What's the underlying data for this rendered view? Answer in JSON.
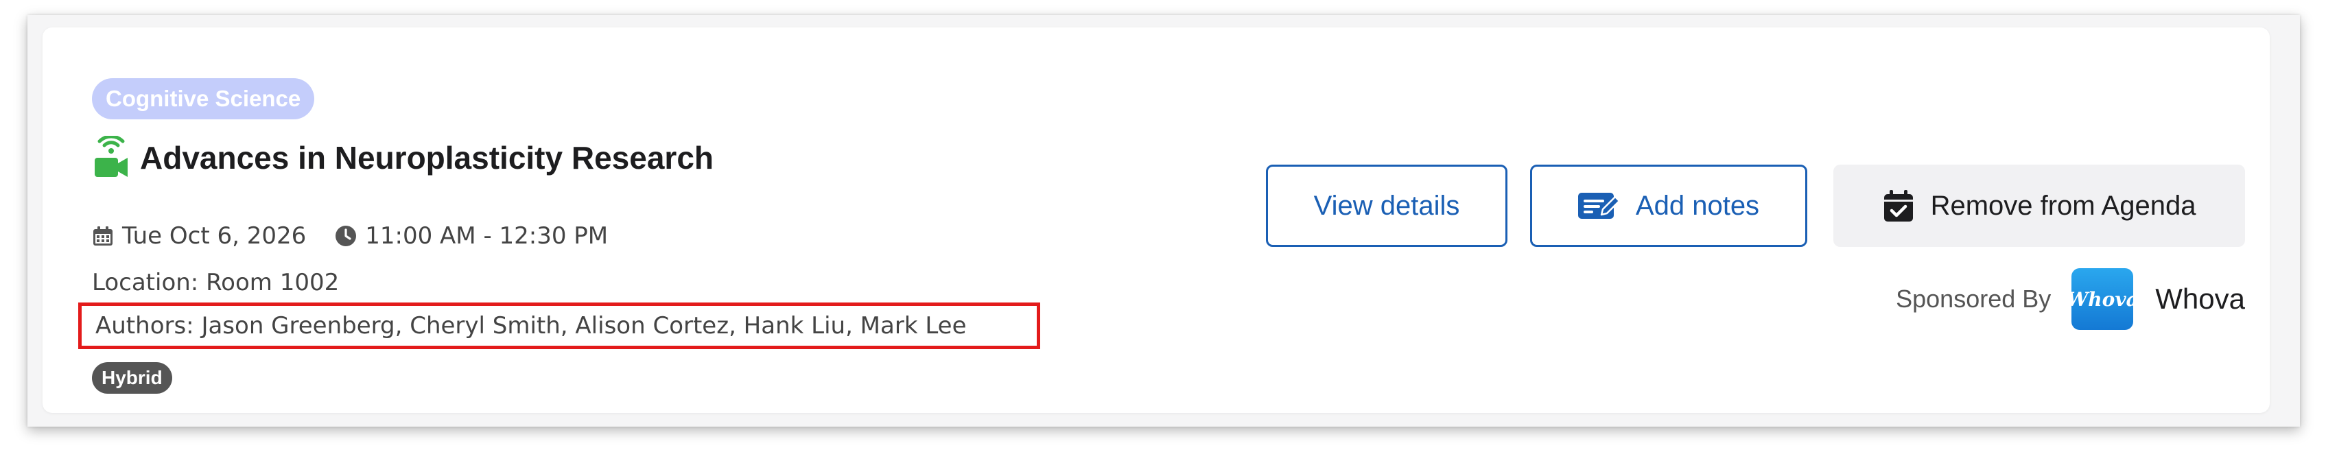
{
  "session": {
    "category": "Cognitive Science",
    "title": "Advances in Neuroplasticity Research",
    "date": "Tue Oct 6, 2026",
    "time": "11:00 AM - 12:30 PM",
    "location": "Location: Room 1002",
    "authors": "Authors: Jason Greenberg, Cheryl Smith, Alison Cortez, Hank Liu, Mark Lee",
    "mode": "Hybrid"
  },
  "actions": {
    "view_details": "View details",
    "add_notes": "Add notes",
    "remove_agenda": "Remove from Agenda"
  },
  "sponsor": {
    "label": "Sponsored By",
    "logo_text": "Whova",
    "name": "Whova"
  },
  "icons": {
    "session_type": "livestream-camera-icon",
    "date": "calendar-icon",
    "time": "clock-icon",
    "notes": "edit-note-icon",
    "remove": "calendar-check-icon"
  },
  "colors": {
    "category_badge": "#c4cdfb",
    "livestream_icon": "#3cb34a",
    "primary": "#1a5fb4",
    "highlight_border": "#e31b1b",
    "mode_badge": "#555555",
    "remove_bg": "#f1f1f3",
    "sponsor_logo": "#1a8ee0"
  }
}
